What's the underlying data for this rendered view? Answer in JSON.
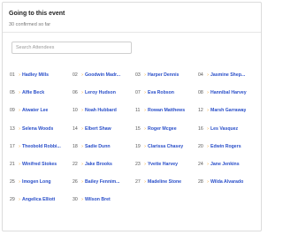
{
  "event": {
    "title": "Going to this event",
    "subtitle": "30 confirmed so far"
  },
  "search": {
    "placeholder": "Search Attendees"
  },
  "chevron_glyph": "›",
  "accent_colors": {
    "name_link": "#2a4fc9",
    "chevron": "#f0a020"
  },
  "attendees": [
    {
      "num": "01",
      "name": "Hadley Mills"
    },
    {
      "num": "02",
      "name": "Goodwin Madr..."
    },
    {
      "num": "03",
      "name": "Harper Dennis"
    },
    {
      "num": "04",
      "name": "Jasmine Shep..."
    },
    {
      "num": "05",
      "name": "Alfie Beck"
    },
    {
      "num": "06",
      "name": "Leroy Hudson"
    },
    {
      "num": "07",
      "name": "Eva Robson"
    },
    {
      "num": "08",
      "name": "Hannibal Harvey"
    },
    {
      "num": "09",
      "name": "Atwater Lee"
    },
    {
      "num": "10",
      "name": "Noah Hubbard"
    },
    {
      "num": "11",
      "name": "Rowan Matthews"
    },
    {
      "num": "12",
      "name": "Marsh Garraway"
    },
    {
      "num": "13",
      "name": "Selena Woods"
    },
    {
      "num": "14",
      "name": "Elbert Shaw"
    },
    {
      "num": "15",
      "name": "Roger Mcgee"
    },
    {
      "num": "16",
      "name": "Les Vasquez"
    },
    {
      "num": "17",
      "name": "Theobold Robbi..."
    },
    {
      "num": "18",
      "name": "Sadie Dunn"
    },
    {
      "num": "19",
      "name": "Clarissa Chasey"
    },
    {
      "num": "20",
      "name": "Edwin Rogers"
    },
    {
      "num": "21",
      "name": "Winifred Stokes"
    },
    {
      "num": "22",
      "name": "Jake Brooks"
    },
    {
      "num": "23",
      "name": "Yvette Harvey"
    },
    {
      "num": "24",
      "name": "Jane Jenkins"
    },
    {
      "num": "25",
      "name": "Imogen Long"
    },
    {
      "num": "26",
      "name": "Bailey Fennim..."
    },
    {
      "num": "27",
      "name": "Madeline Stone"
    },
    {
      "num": "28",
      "name": "Wilda Alvarado"
    },
    {
      "num": "29",
      "name": "Angelica Elliott"
    },
    {
      "num": "30",
      "name": "Wilson Bret"
    }
  ]
}
